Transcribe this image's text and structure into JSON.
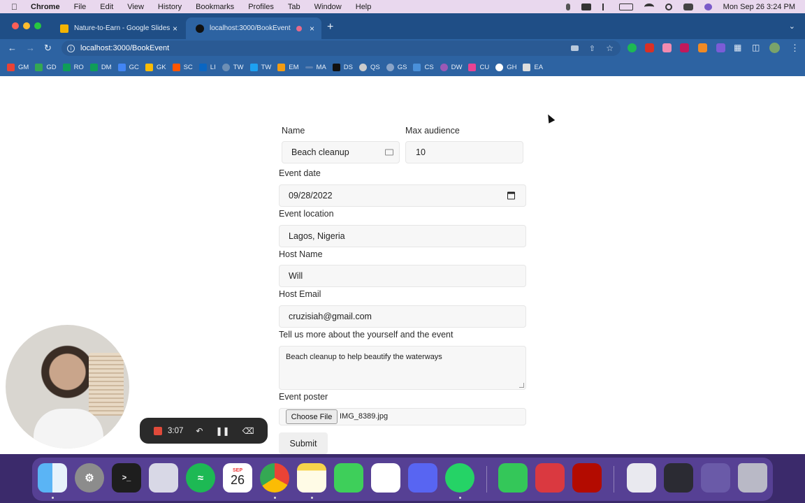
{
  "menubar": {
    "app": "Chrome",
    "items": [
      "File",
      "Edit",
      "View",
      "History",
      "Bookmarks",
      "Profiles",
      "Tab",
      "Window",
      "Help"
    ],
    "clock": "Mon Sep 26  3:24 PM"
  },
  "tabs": [
    {
      "title": "Nature-to-Earn - Google Slides",
      "favicon_color": "#f4b400"
    },
    {
      "title": "localhost:3000/BookEvent",
      "favicon_color": "#111111"
    }
  ],
  "address_bar": {
    "url": "localhost:3000/BookEvent"
  },
  "bookmarks": [
    {
      "label": "GM",
      "color": "#ea4335"
    },
    {
      "label": "GD",
      "color": "#34a853"
    },
    {
      "label": "RO",
      "color": "#0f9d58"
    },
    {
      "label": "DM",
      "color": "#0f9d58"
    },
    {
      "label": "GC",
      "color": "#4285f4"
    },
    {
      "label": "GK",
      "color": "#fbbc04"
    },
    {
      "label": "SC",
      "color": "#ff5500"
    },
    {
      "label": "LI",
      "color": "#0a66c2"
    },
    {
      "label": "TW",
      "color": "#6d8fb5"
    },
    {
      "label": "TW",
      "color": "#1da1f2"
    },
    {
      "label": "EM",
      "color": "#f39c12"
    },
    {
      "label": "MA",
      "color": "#5a7fb0"
    },
    {
      "label": "DS",
      "color": "#111111"
    },
    {
      "label": "QS",
      "color": "#cccccc"
    },
    {
      "label": "GS",
      "color": "#8aa4c8"
    },
    {
      "label": "CS",
      "color": "#4a90d9"
    },
    {
      "label": "DW",
      "color": "#9b59b6"
    },
    {
      "label": "CU",
      "color": "#e84393"
    },
    {
      "label": "GH",
      "color": "#ffffff"
    },
    {
      "label": "EA",
      "color": "#dddddd"
    }
  ],
  "form": {
    "name": {
      "label": "Name",
      "value": "Beach cleanup"
    },
    "max_audience": {
      "label": "Max audience",
      "value": "10"
    },
    "event_date": {
      "label": "Event date",
      "value": "09/28/2022"
    },
    "event_location": {
      "label": "Event location",
      "value": "Lagos, Nigeria"
    },
    "host_name": {
      "label": "Host Name",
      "value": "Will"
    },
    "host_email": {
      "label": "Host Email",
      "value": "cruzisiah@gmail.com"
    },
    "about": {
      "label": "Tell us more about the yourself and the event",
      "value": "Beach cleanup to help beautify the waterways"
    },
    "poster": {
      "label": "Event poster",
      "button": "Choose File",
      "filename": "IMG_8389.jpg"
    },
    "submit": "Submit"
  },
  "recorder": {
    "time": "3:07"
  },
  "dock": {
    "calendar_month": "SEP",
    "calendar_day": "26"
  }
}
